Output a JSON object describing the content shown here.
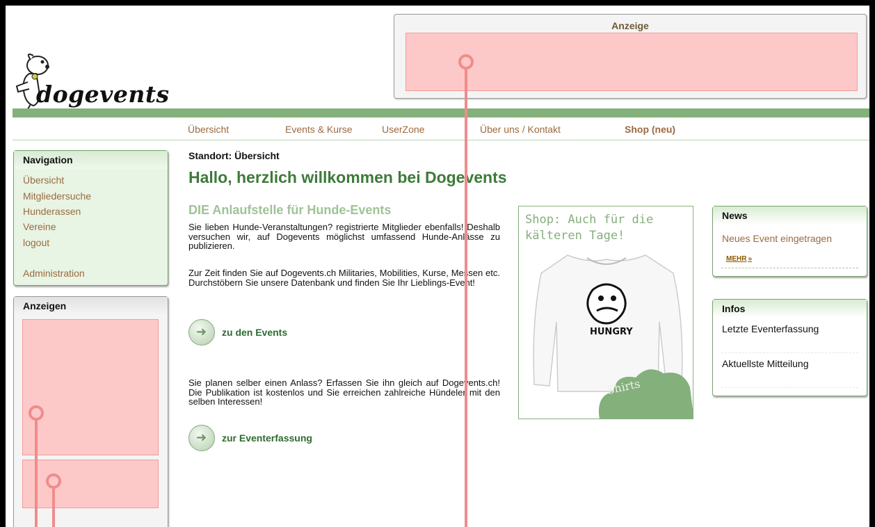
{
  "site": {
    "name": "dogevents"
  },
  "top_ad": {
    "title": "Anzeige"
  },
  "topnav": {
    "items": [
      "Übersicht",
      "Events & Kurse",
      "UserZone",
      "Über uns / Kontakt",
      "Shop (neu)"
    ]
  },
  "sidebar": {
    "title": "Navigation",
    "items": [
      "Übersicht",
      "Mitgliedersuche",
      "Hunderassen",
      "Vereine",
      "logout"
    ],
    "admin": "Administration"
  },
  "ads_box": {
    "title": "Anzeigen"
  },
  "main": {
    "breadcrumb": "Standort: Übersicht",
    "welcome": "Hallo, herzlich willkommen bei Dogevents",
    "subhead": "DIE Anlaufstelle für Hunde-Events",
    "para1": "Sie lieben Hunde-Veranstaltungen? registrierte Mitglieder ebenfalls! Deshalb versuchen wir, auf Dogevents möglichst umfassend Hunde-Anlässe zu publizieren.",
    "para2": "Zur Zeit finden Sie auf Dogevents.ch Militaries, Mobilities, Kurse, Messen etc. Durchstöbern Sie unsere Datenbank und finden Sie Ihr Lieblings-Event!",
    "cta1": "zu den Events",
    "para3": "Sie planen selber einen Anlass? Erfassen Sie ihn gleich auf Dogevents.ch! Die Publikation ist kostenlos und Sie erreichen zahlreiche Hündeler mit den selben Interessen!",
    "cta2": "zur Eventerfassung"
  },
  "shop": {
    "title": "Shop: Auch für die kälteren Tage!",
    "shirt_print": "HUNGRY",
    "shirts_label": "Shirts"
  },
  "news": {
    "title": "News",
    "item": "Neues Event eingetragen",
    "more": "MEHR",
    "more_arrows": "»"
  },
  "infos": {
    "title": "Infos",
    "items": [
      "Letzte Eventerfassung",
      "Aktuellste Mitteilung"
    ]
  },
  "colors": {
    "accent_green": "#84b07c",
    "heading_green": "#3e7a3a",
    "link_brown": "#9b6a3f",
    "ad_placeholder": "#fdc8c8",
    "marker": "#f08c8c"
  }
}
